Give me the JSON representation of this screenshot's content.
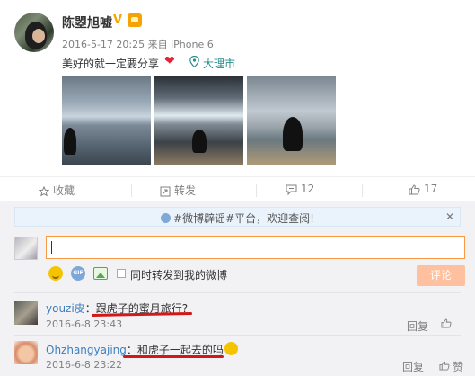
{
  "post": {
    "username": "陈曌旭嘘",
    "verified_badge": "V",
    "meta": "2016-5-17 20:25 来自 iPhone 6",
    "text": "美好的就一定要分享",
    "heart": "❤",
    "location": "大理市"
  },
  "actions": {
    "favorite": "收藏",
    "repost": "转发",
    "comment_count": "12",
    "like_count": "17"
  },
  "notice": {
    "text": "#微博辟谣#平台，欢迎查阅!",
    "close": "✕"
  },
  "reply_box": {
    "repost_checkbox_label": "同时转发到我的微博",
    "submit_label": "评论",
    "gif_label": "GIF"
  },
  "comments": [
    {
      "user": "youzi皮",
      "sep": "：",
      "text": "跟虎子的蜜月旅行?",
      "time": "2016-6-8 23:43",
      "reply": "回复",
      "like": ""
    },
    {
      "user": "Ohzhangyajing",
      "sep": "：",
      "text": "和虎子一起去的吗",
      "time": "2016-6-8 23:22",
      "reply": "回复",
      "like": "赞"
    }
  ],
  "colors": {
    "link_blue": "#3d7fbf",
    "location_teal": "#2a8d8a",
    "input_border": "#f99944",
    "submit_bg": "#ffc09f",
    "underline_red": "#d21818"
  }
}
